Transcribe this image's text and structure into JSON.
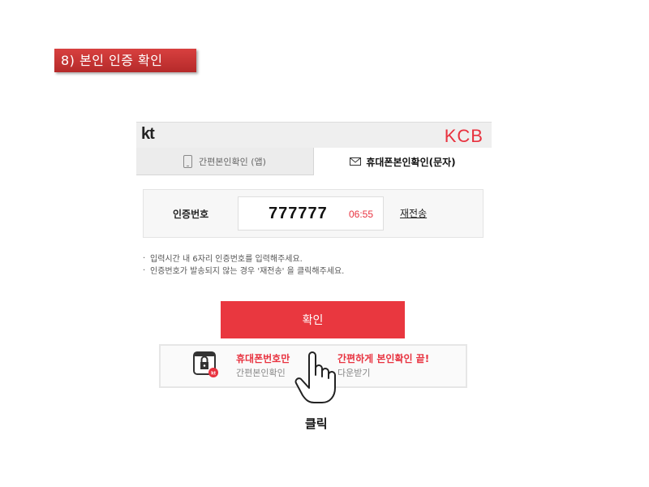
{
  "step_title": "8) 본인 인증 확인",
  "header": {
    "left_logo": "kt",
    "right_logo": "KCB"
  },
  "tabs": [
    {
      "label": "간편본인확인 (앱)",
      "icon": "phone-icon",
      "active": false
    },
    {
      "label": "휴대폰본인확인(문자)",
      "icon": "mail-icon",
      "active": true
    }
  ],
  "auth": {
    "label": "인증번호",
    "code_value": "777777",
    "timer": "06:55",
    "resend_label": "재전송"
  },
  "notes": [
    "입력시간 내 6자리 인증번호를 입력해주세요.",
    "인증번호가 발송되지 않는 경우 '재전송' 을 클릭해주세요."
  ],
  "confirm_label": "확인",
  "promo": {
    "title_left": "휴대폰번호만",
    "sub_left": "간편본인확인",
    "title_right": "간편하게 본인확인 끝!",
    "sub_right": "다운받기",
    "badge_text": "kt"
  },
  "annotation": {
    "click_label": "클릭",
    "hand_icon": "pointer-hand-icon"
  },
  "colors": {
    "accent": "#e9373f",
    "badge": "#c13434",
    "timer": "#e8323f"
  }
}
